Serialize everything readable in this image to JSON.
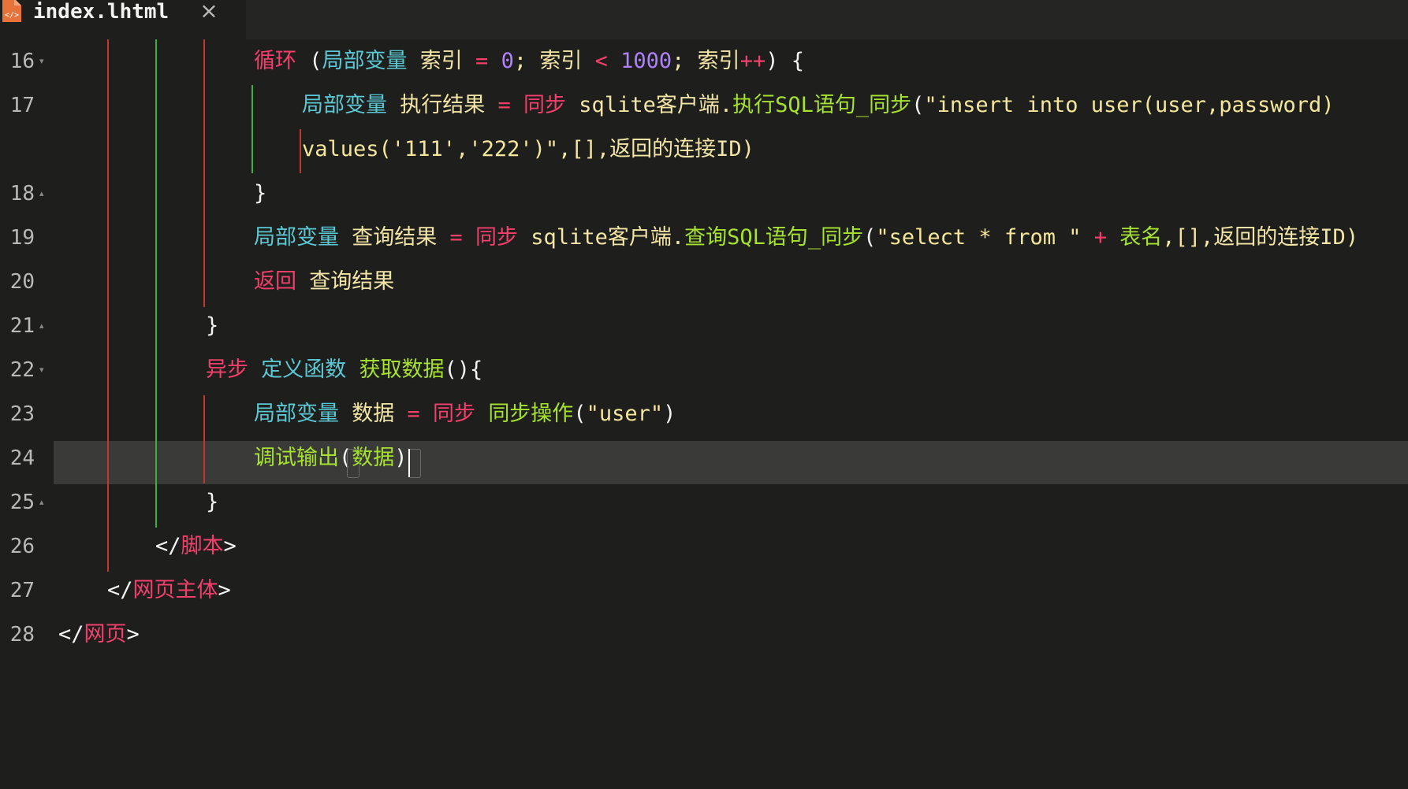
{
  "tab": {
    "title": "index.lhtml",
    "close_glyph": "×",
    "icon": "html-file-icon"
  },
  "colors": {
    "background": "#1e1f1d",
    "keyword": "#f43f6c",
    "variable_decl": "#5bc8d4",
    "function": "#a6e22e",
    "identifier": "#f2e5a6",
    "number": "#ae81ff",
    "string": "#f5e79a",
    "current_line": "#3a3b39"
  },
  "lines": [
    {
      "n": "16",
      "fold": "▾"
    },
    {
      "n": "17",
      "fold": ""
    },
    {
      "n": "",
      "fold": ""
    },
    {
      "n": "18",
      "fold": "▴"
    },
    {
      "n": "19",
      "fold": ""
    },
    {
      "n": "20",
      "fold": ""
    },
    {
      "n": "21",
      "fold": "▴"
    },
    {
      "n": "22",
      "fold": "▾"
    },
    {
      "n": "23",
      "fold": ""
    },
    {
      "n": "24",
      "fold": ""
    },
    {
      "n": "25",
      "fold": "▴"
    },
    {
      "n": "26",
      "fold": ""
    },
    {
      "n": "27",
      "fold": ""
    },
    {
      "n": "28",
      "fold": ""
    }
  ],
  "code": {
    "l16": [
      "循环",
      " (",
      "局部变量",
      " 索引 ",
      "=",
      " ",
      "0",
      "; 索引 ",
      "<",
      " ",
      "1000",
      "; 索引",
      "++",
      ") {"
    ],
    "l17": [
      "局部变量",
      " 执行结果 ",
      "=",
      " ",
      "同步",
      " sqlite客户端.",
      "执行SQL语句_同步",
      "(",
      "\"insert into user(user,password)"
    ],
    "l17b": [
      "values('111','222')\"",
      ",[],返回的连接ID)"
    ],
    "l18": [
      "}"
    ],
    "l19": [
      "局部变量",
      " 查询结果 ",
      "=",
      " ",
      "同步",
      " sqlite客户端.",
      "查询SQL语句_同步",
      "(",
      "\"select * from \"",
      " ",
      "+",
      " ",
      "表名",
      ",[],返回的连接ID)"
    ],
    "l20": [
      "返回",
      " 查询结果"
    ],
    "l21": [
      "}"
    ],
    "l22": [
      "异步",
      " ",
      "定义函数",
      " ",
      "获取数据",
      "(){"
    ],
    "l23": [
      "局部变量",
      " 数据 ",
      "=",
      " ",
      "同步",
      " ",
      "同步操作",
      "(",
      "\"user\"",
      ")"
    ],
    "l24": [
      "调试输出",
      "(",
      "数据",
      ")"
    ],
    "l25": [
      "}"
    ],
    "l26": [
      "</",
      "脚本",
      ">"
    ],
    "l27": [
      "</",
      "网页主体",
      ">"
    ],
    "l28": [
      "</",
      "网页",
      ">"
    ]
  }
}
